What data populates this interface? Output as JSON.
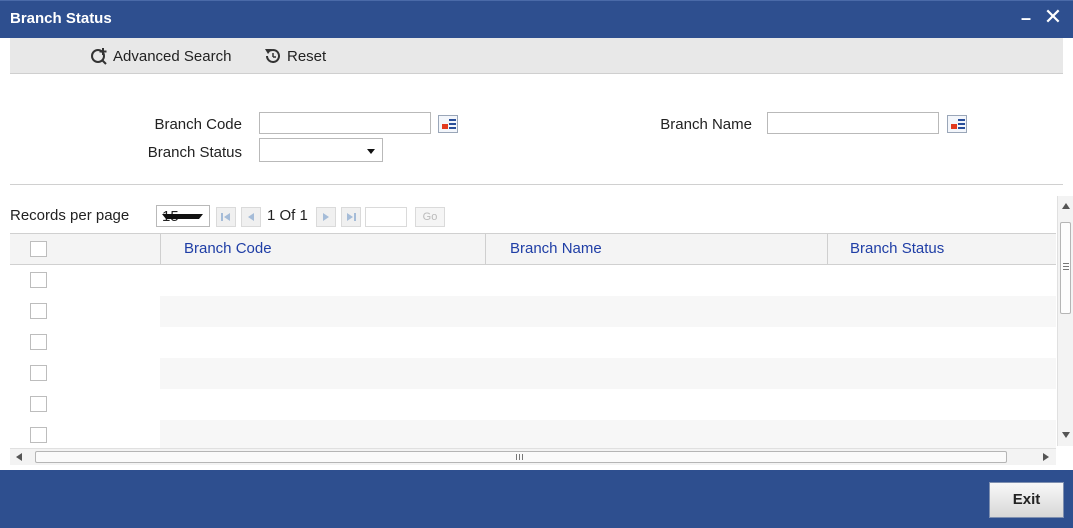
{
  "window": {
    "title": "Branch Status",
    "minimize": "–",
    "close": "✕"
  },
  "toolbar": {
    "advanced_search_label": "Advanced Search",
    "reset_label": "Reset"
  },
  "form": {
    "branch_code_label": "Branch Code",
    "branch_code_value": "",
    "branch_name_label": "Branch Name",
    "branch_name_value": "",
    "branch_status_label": "Branch Status",
    "branch_status_value": ""
  },
  "grid": {
    "records_per_page_label": "Records per page",
    "records_per_page_value": "15",
    "page_text": "1 Of 1",
    "go_label": "Go",
    "columns": [
      "Branch Code",
      "Branch Name",
      "Branch Status"
    ],
    "row_count": 6
  },
  "footer": {
    "exit_label": "Exit"
  },
  "colors": {
    "titlebar": "#2e4f8f",
    "header_text": "#1f3ea6",
    "row_alt": "#f7f7f7"
  }
}
